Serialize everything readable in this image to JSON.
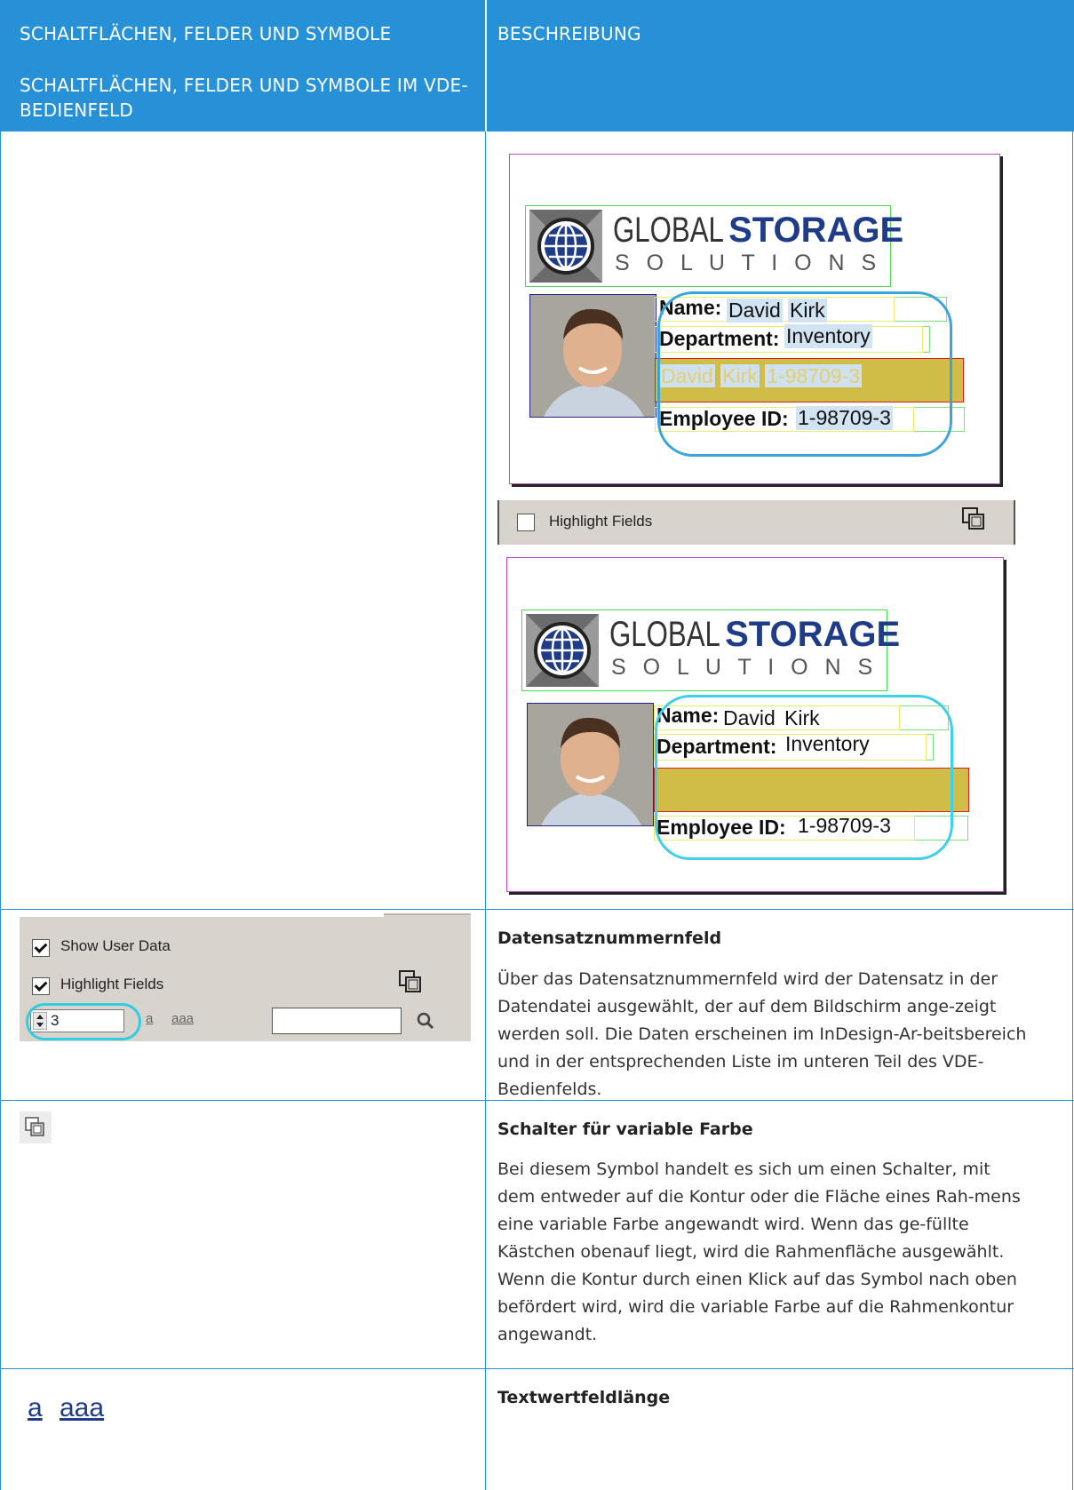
{
  "header": {
    "col1_line1": "SCHALTFLÄCHEN, FELDER UND SYMBOLE",
    "col1_line2": "SCHALTFLÄCHEN, FELDER UND SYMBOLE IM VDE-BEDIENFELD",
    "col2": "BESCHREIBUNG"
  },
  "card": {
    "logo_global": "GLOBAL",
    "logo_storage": "STORAGE",
    "logo_solutions": "S O L U T I O N S",
    "name_label": "Name:",
    "name_first": "David",
    "name_last": "Kirk",
    "dept_label": "Department:",
    "dept_value": "Inventory",
    "overlay_first": "David",
    "overlay_last": "Kirk",
    "overlay_id": "1-98709-3",
    "emp_label": "Employee ID:",
    "emp_value": "1-98709-3"
  },
  "toolbar": {
    "highlight_label": "Highlight Fields"
  },
  "panel": {
    "show_user_data": "Show User Data",
    "highlight_fields": "Highlight Fields",
    "record_number": "3",
    "text_a": "a",
    "text_aaa": "aaa",
    "search_value": ""
  },
  "rows": [
    {
      "title": "Datensatznummernfeld",
      "body": "Über das Datensatznummernfeld wird der Datensatz in der Datendatei ausgewählt, der auf dem Bildschirm ange-zeigt werden soll. Die Daten erscheinen im InDesign-Ar-beitsbereich und in der entsprechenden Liste im unteren Teil des VDE-Bedienfelds."
    },
    {
      "title": "Schalter für variable Farbe",
      "body": "Bei diesem Symbol handelt es sich um einen Schalter, mit dem entweder auf die Kontur oder die Fläche eines Rah-mens eine variable Farbe angewandt wird. Wenn das ge-füllte Kästchen obenauf liegt, wird die Rahmenfläche ausgewählt. Wenn die Kontur durch einen Klick auf das Symbol nach oben befördert wird, wird die variable Farbe auf die Rahmenkontur angewandt."
    },
    {
      "title": "Textwertfeldlänge",
      "icon_a": "a",
      "icon_aaa": "aaa"
    }
  ],
  "colors": {
    "header_bg": "#2791d8",
    "grid_line": "#2791d8",
    "highlight_olive": "#cfbd47",
    "oval_blue": "#3aa5dc",
    "oval_cyan": "#31cde2"
  }
}
